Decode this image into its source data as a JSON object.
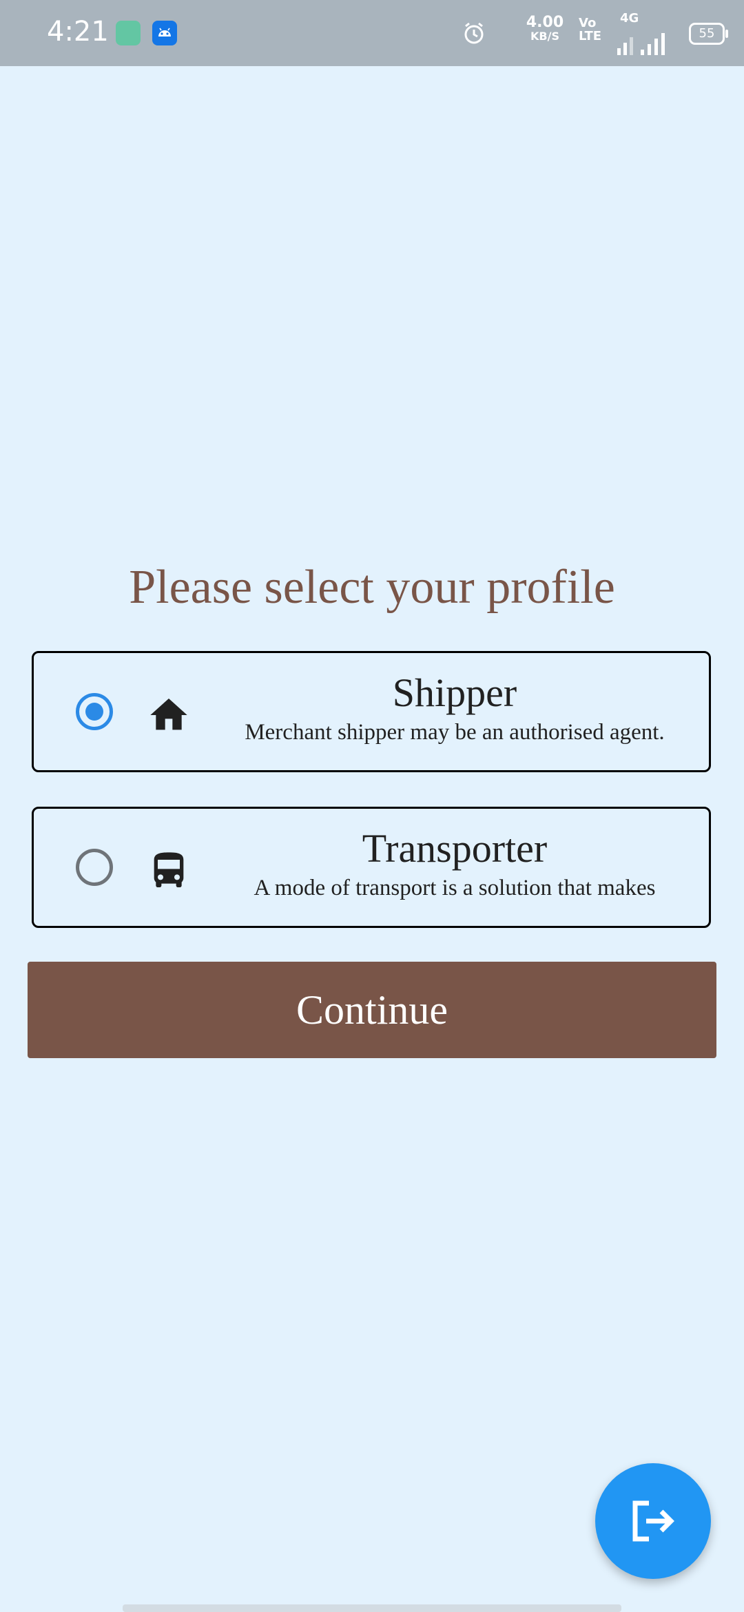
{
  "status_bar": {
    "time": "4:21",
    "net_speed_value": "4.00",
    "net_speed_unit": "KB/S",
    "volte_top": "Vo",
    "volte_bottom": "LTE",
    "network_type": "4G",
    "battery_level": "55",
    "icons": [
      "app-notification-icon",
      "android-icon",
      "alarm-icon",
      "signal-icon",
      "battery-icon"
    ]
  },
  "main": {
    "title": "Please select your profile",
    "options": [
      {
        "title": "Shipper",
        "subtitle": "Merchant shipper may be an authorised agent.",
        "icon": "home-icon",
        "selected": true
      },
      {
        "title": "Transporter",
        "subtitle": "A mode of transport is a solution that makes",
        "icon": "bus-icon",
        "selected": false
      }
    ],
    "continue_label": "Continue"
  },
  "fab": {
    "icon": "logout-icon"
  },
  "colors": {
    "background": "#e3f2fd",
    "accent": "#795548",
    "radio_selected": "#2b8ae6",
    "fab": "#2196f3",
    "status_bar": "#a9b4bd"
  }
}
